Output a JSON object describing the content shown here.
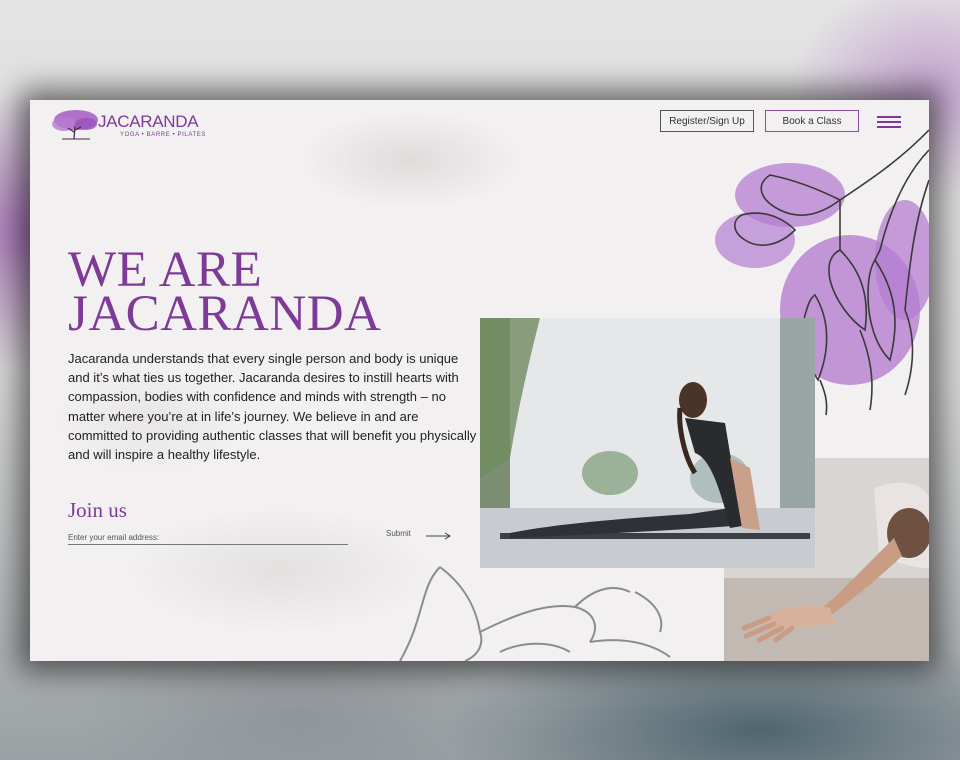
{
  "brand": {
    "name": "JACARANDA",
    "tagline": "YOGA • BARRE • PILATES",
    "color": "#7d3a96"
  },
  "header": {
    "register_label": "Register/Sign Up",
    "book_label": "Book a Class",
    "menu_icon": "hamburger-icon"
  },
  "hero": {
    "title_line1": "WE ARE",
    "title_line2": "JACARANDA",
    "intro": "Jacaranda understands that every single person and body is unique and it’s what ties us together. Jacaranda desires to instill hearts with compassion, bodies with confidence and minds with strength – no matter where you’re at in life’s journey. We believe in and are committed to providing authentic classes that will benefit you physically and will inspire a healthy lifestyle."
  },
  "join": {
    "heading": "Join us",
    "email_placeholder": "Enter your email address:",
    "submit_label": "Submit",
    "arrow_icon": "arrow-right-icon"
  },
  "images": {
    "main": "yoga-cobra-pose-photo",
    "secondary": "stretching-hand-photo",
    "decor_top": "jacaranda-flower-illustration",
    "decor_bottom": "flower-line-illustration"
  }
}
